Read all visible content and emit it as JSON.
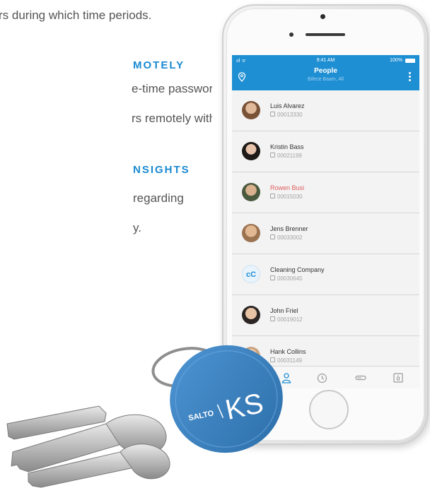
{
  "marketing": {
    "line1": "rs during which time periods.",
    "heading2": "MOTELY",
    "line2a": "e-time password technology,",
    "line2b": "rs remotely without a key.",
    "heading3": "NSIGHTS",
    "line3a": "regarding",
    "line3b": "y."
  },
  "status_bar": {
    "signal": "ııl ᯤ",
    "time": "9:41 AM",
    "battery": "100%"
  },
  "header": {
    "title": "People",
    "subtitle": "Bifece Baam, All"
  },
  "people": [
    {
      "name": "Luis Alvarez",
      "code": "00013330",
      "highlight": false,
      "avatar": "photo"
    },
    {
      "name": "Kristin Bass",
      "code": "00021199",
      "highlight": false,
      "avatar": "photo"
    },
    {
      "name": "Rowen Busi",
      "code": "00015030",
      "highlight": true,
      "avatar": "photo"
    },
    {
      "name": "Jens Brenner",
      "code": "00033002",
      "highlight": false,
      "avatar": "photo"
    },
    {
      "name": "Cleaning Company",
      "code": "00030645",
      "highlight": false,
      "avatar": "initials",
      "initials": "cC"
    },
    {
      "name": "John Friel",
      "code": "00019012",
      "highlight": false,
      "avatar": "photo"
    },
    {
      "name": "Hank Collins",
      "code": "00031149",
      "highlight": false,
      "avatar": "photo"
    }
  ],
  "tabs": [
    "lock-icon",
    "people-icon",
    "history-icon",
    "key-icon",
    "access-point-icon"
  ],
  "keyfob": {
    "brand": "SALTO",
    "logo": "KS"
  },
  "colors": {
    "accent": "#1f8fd3",
    "alert": "#e05a5a",
    "fob": "#3d83c4"
  }
}
